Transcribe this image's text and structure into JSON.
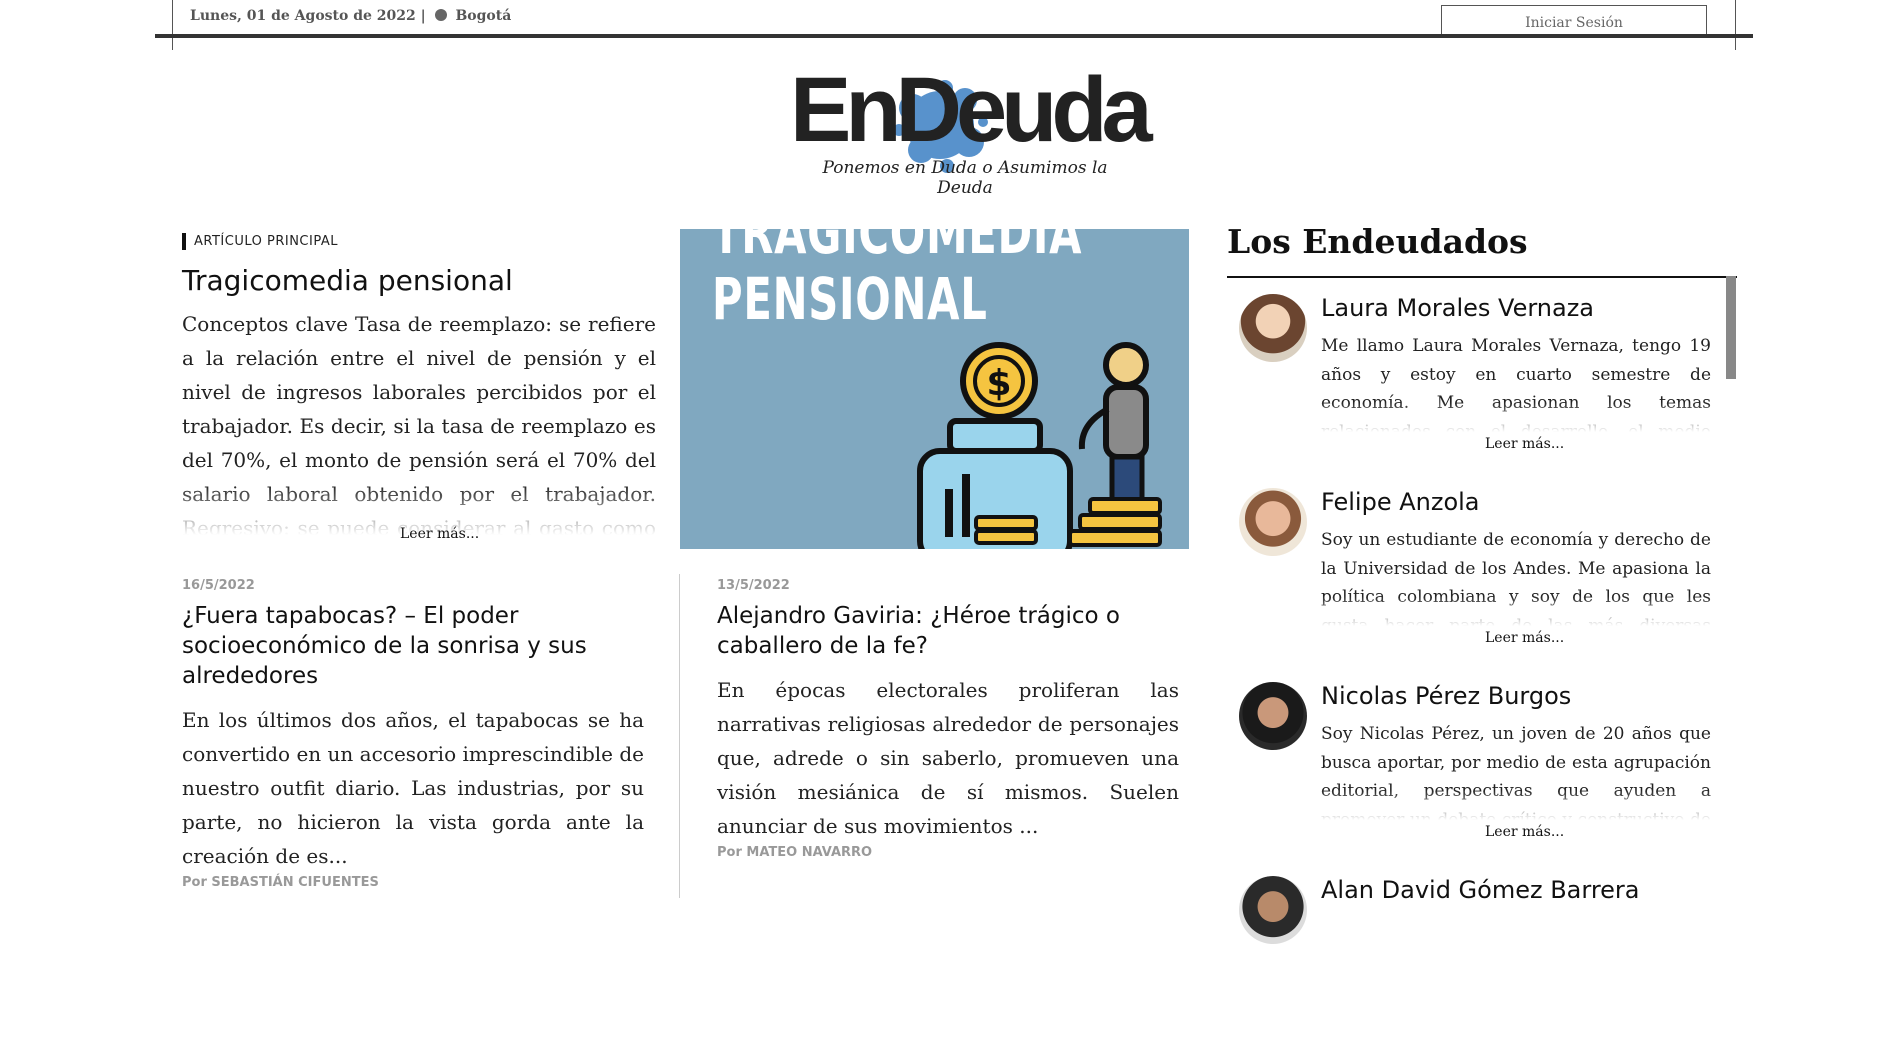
{
  "header": {
    "date": "Lunes, 01 de Agosto de 2022",
    "city": "Bogotá",
    "login_label": "Iniciar Sesión"
  },
  "brand": {
    "logo_text": "EnDeuda",
    "tagline": "Ponemos en Duda o Asumimos la Deuda",
    "splash_color": "#3b7fc4"
  },
  "main_article": {
    "kicker": "ARTÍCULO PRINCIPAL",
    "title": "Tragicomedia pensional",
    "excerpt": "Conceptos clave Tasa de reemplazo: se refiere a la relación entre el nivel de pensión y el nivel de ingresos laborales percibidos por el trabajador. Es decir, si la tasa de reemplazo es del 70%, el monto de pensión será el 70% del salario laboral obtenido por el trabajador. Regresivo: se puede considerar al gasto como regresivo cuando este",
    "read_more": "Leer más...",
    "image_line1": "TRAGICOMEDIA",
    "image_line2": "PENSIONAL",
    "image_bg": "#80a8c0"
  },
  "articles": [
    {
      "date": "16/5/2022",
      "title": "¿Fuera tapabocas? – El poder socioeconómico de la sonrisa y sus alrededores",
      "excerpt": "En los últimos dos años, el tapabocas se ha convertido en un accesorio imprescindible de nuestro outfit diario. Las industrias, por su parte, no hicieron la vista gorda ante la creación de es...",
      "author": "Por SEBASTIÁN CIFUENTES"
    },
    {
      "date": "13/5/2022",
      "title": "Alejandro Gaviria: ¿Héroe trágico o caballero de la fe?",
      "excerpt": "En épocas electorales proliferan las narrativas religiosas alrededor de personajes que, adrede o sin saberlo, promueven una visión mesiánica de sí mismos. Suelen anunciar de sus movimientos ...",
      "author": "Por MATEO NAVARRO"
    }
  ],
  "sidebar": {
    "title": "Los Endeudados",
    "members": [
      {
        "name": "Laura Morales Vernaza",
        "bio": "Me llamo Laura Morales Vernaza, tengo 19 años y estoy en cuarto semestre de economía. Me apasionan los temas relacionados con el desarrollo, el medio ambiente y la historia, y",
        "more": "Leer más..."
      },
      {
        "name": "Felipe Anzola",
        "bio": "Soy un estudiante de economía y derecho de la Universidad de los Andes. Me apasiona la política colombiana y soy de los que les gusta hacer parte de las más diversas discusiones y",
        "more": "Leer más..."
      },
      {
        "name": "Nicolas Pérez Burgos",
        "bio": "Soy Nicolas Pérez, un joven de 20 años que busca aportar, por medio de esta agrupación editorial, perspectivas que ayuden a promover un debate crítico y constructivo de las",
        "more": "Leer más..."
      },
      {
        "name": "Alan David Gómez Barrera",
        "bio": "",
        "more": ""
      }
    ]
  }
}
